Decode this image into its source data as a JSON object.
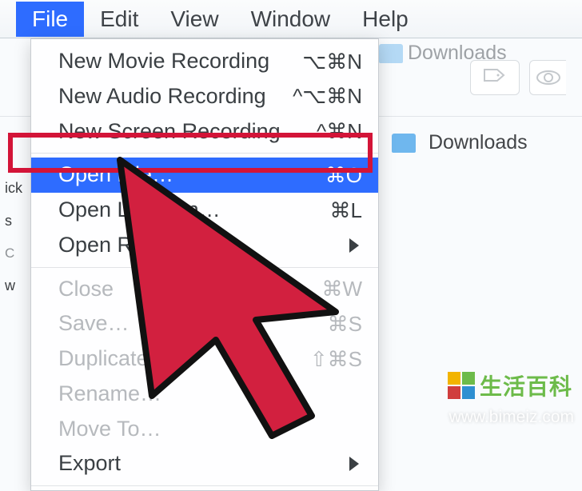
{
  "menubar": {
    "items": [
      {
        "label": "File",
        "active": true
      },
      {
        "label": "Edit"
      },
      {
        "label": "View"
      },
      {
        "label": "Window"
      },
      {
        "label": "Help"
      }
    ]
  },
  "dropdown": {
    "groups": [
      [
        {
          "label": "New Movie Recording",
          "shortcut": "⌥⌘N"
        },
        {
          "label": "New Audio Recording",
          "shortcut": "^⌥⌘N"
        },
        {
          "label": "New Screen Recording",
          "shortcut": "^⌘N"
        }
      ],
      [
        {
          "label": "Open File…",
          "shortcut": "⌘O",
          "highlighted": true
        },
        {
          "label": "Open Location…",
          "shortcut": "⌘L"
        },
        {
          "label": "Open Recent",
          "submenu": true
        }
      ],
      [
        {
          "label": "Close",
          "shortcut": "⌘W",
          "disabled": true
        },
        {
          "label": "Save…",
          "shortcut": "⌘S",
          "disabled": true
        },
        {
          "label": "Duplicate",
          "shortcut": "⇧⌘S",
          "disabled": true
        },
        {
          "label": "Rename…",
          "disabled": true
        },
        {
          "label": "Move To…",
          "disabled": true
        },
        {
          "label": "Export",
          "submenu": true
        }
      ]
    ]
  },
  "finder": {
    "location": "Downloads",
    "breadcrumb": "Downloads"
  },
  "sidebar": {
    "items": [
      "ick",
      "s",
      "C",
      "w"
    ]
  },
  "watermark": {
    "logo_text": "生活百科",
    "url": "www.bimeiz.com"
  }
}
